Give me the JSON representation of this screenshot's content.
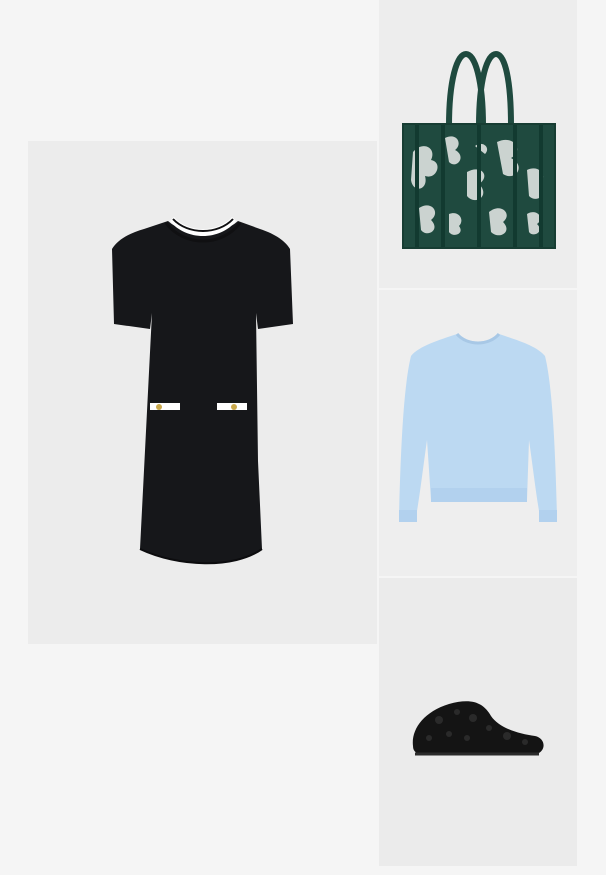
{
  "outfit": {
    "items": [
      {
        "key": "dress",
        "icon": "black-shift-dress",
        "color": "#16171a"
      },
      {
        "key": "bag",
        "icon": "green-cutout-tote-bag",
        "color": "#1f4a3f"
      },
      {
        "key": "sweatshirt",
        "icon": "light-blue-sweatshirt",
        "color": "#bcd9f2"
      },
      {
        "key": "slipper",
        "icon": "black-shearling-slipper",
        "color": "#141414"
      }
    ]
  }
}
